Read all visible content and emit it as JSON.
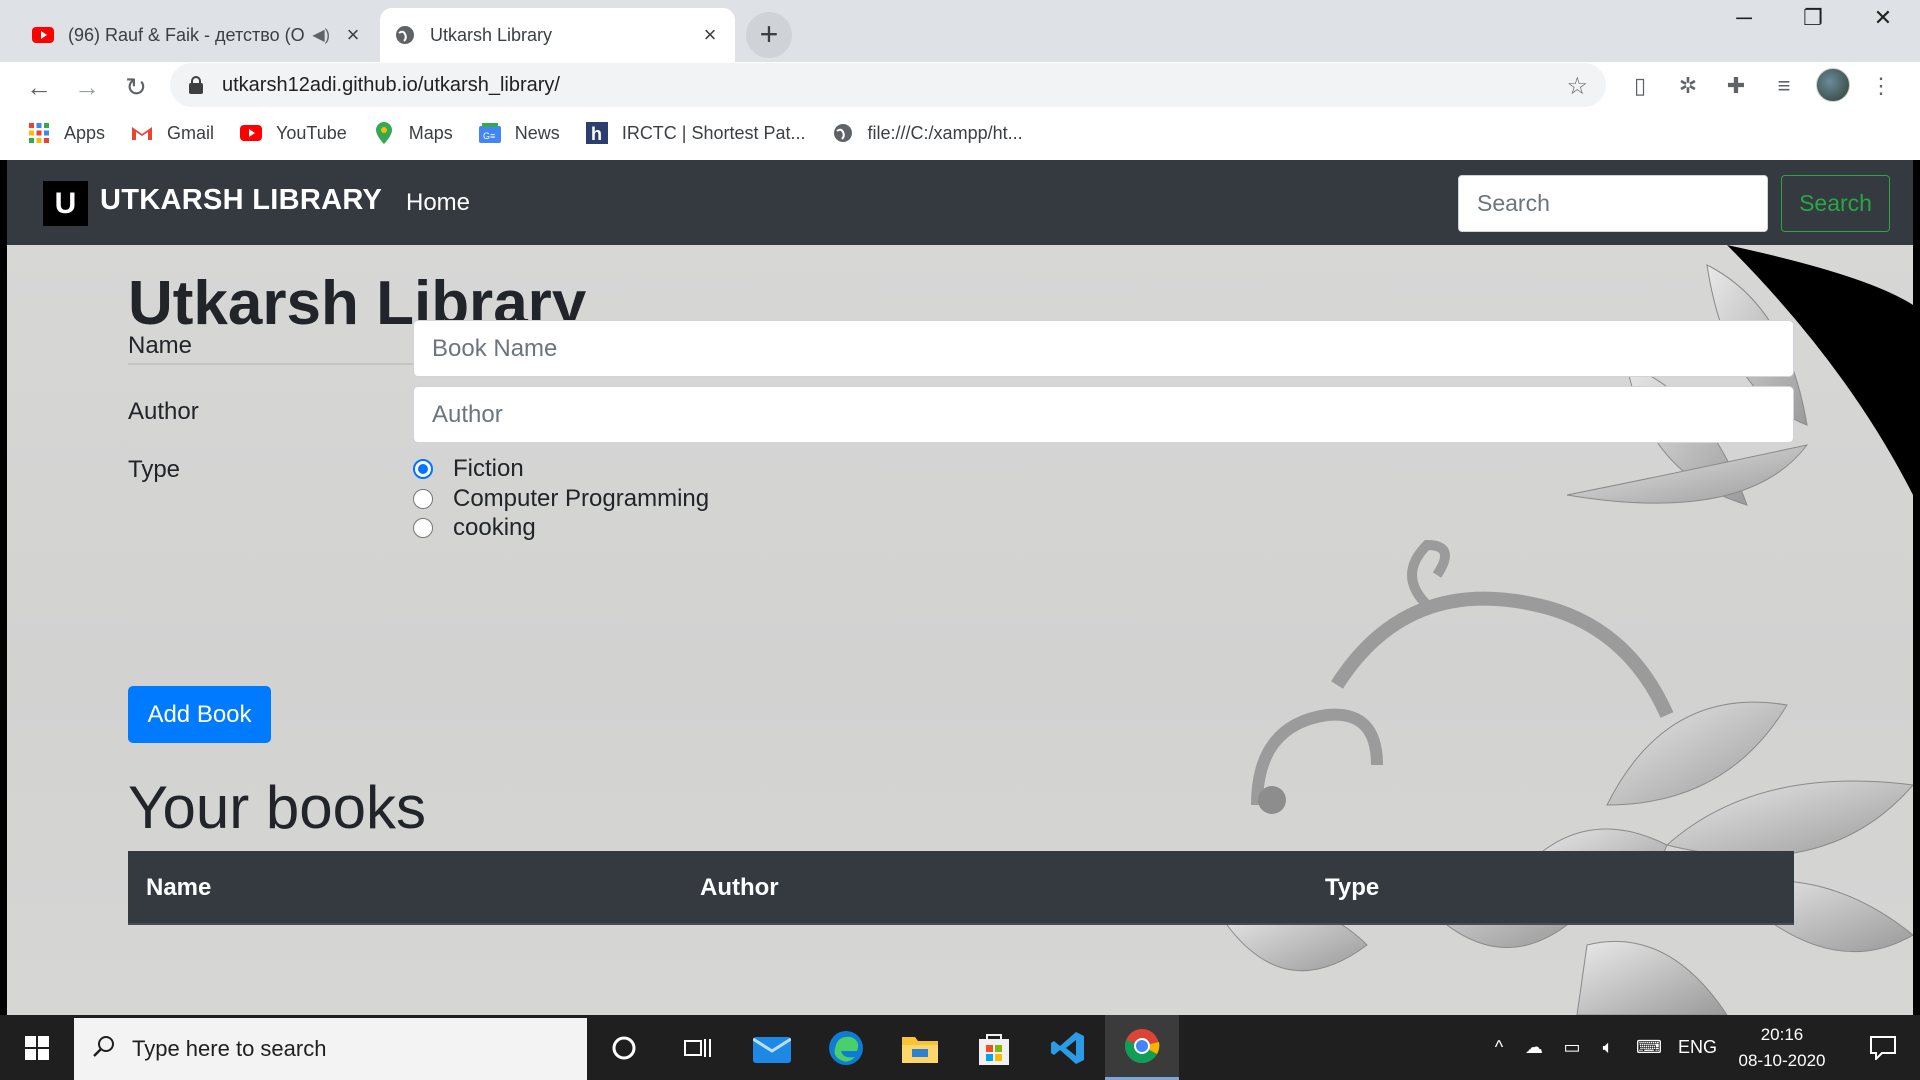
{
  "browser": {
    "tabs": [
      {
        "title": "(96) Rauf & Faik - детство (О",
        "active": false
      },
      {
        "title": "Utkarsh Library",
        "active": true
      }
    ],
    "url": "utkarsh12adi.github.io/utkarsh_library/",
    "bookmarks": [
      {
        "label": "Apps",
        "icon": "apps-grid-icon"
      },
      {
        "label": "Gmail",
        "icon": "gmail-icon"
      },
      {
        "label": "YouTube",
        "icon": "youtube-icon"
      },
      {
        "label": "Maps",
        "icon": "maps-icon"
      },
      {
        "label": "News",
        "icon": "news-icon"
      },
      {
        "label": "IRCTC | Shortest Pat...",
        "icon": "irctc-icon"
      },
      {
        "label": "file:///C:/xampp/ht...",
        "icon": "globe-icon"
      }
    ]
  },
  "navbar": {
    "logo_letter": "U",
    "brand": "UTKARSH LIBRARY",
    "home": "Home",
    "search_placeholder": "Search",
    "search_button": "Search"
  },
  "main": {
    "title": "Utkarsh Library",
    "form": {
      "name_label": "Name",
      "name_placeholder": "Book Name",
      "author_label": "Author",
      "author_placeholder": "Author",
      "type_label": "Type",
      "types": [
        {
          "label": "Fiction",
          "checked": true
        },
        {
          "label": "Computer Programming",
          "checked": false
        },
        {
          "label": "cooking",
          "checked": false
        }
      ],
      "submit": "Add Book"
    },
    "books_heading": "Your books",
    "table_headers": [
      "Name",
      "Author",
      "Type"
    ]
  },
  "taskbar": {
    "search_placeholder": "Type here to search",
    "language": "ENG",
    "time": "20:16",
    "date": "08-10-2020"
  },
  "colors": {
    "navbar": "#343a40",
    "primary": "#007bff",
    "success": "#28a745"
  }
}
